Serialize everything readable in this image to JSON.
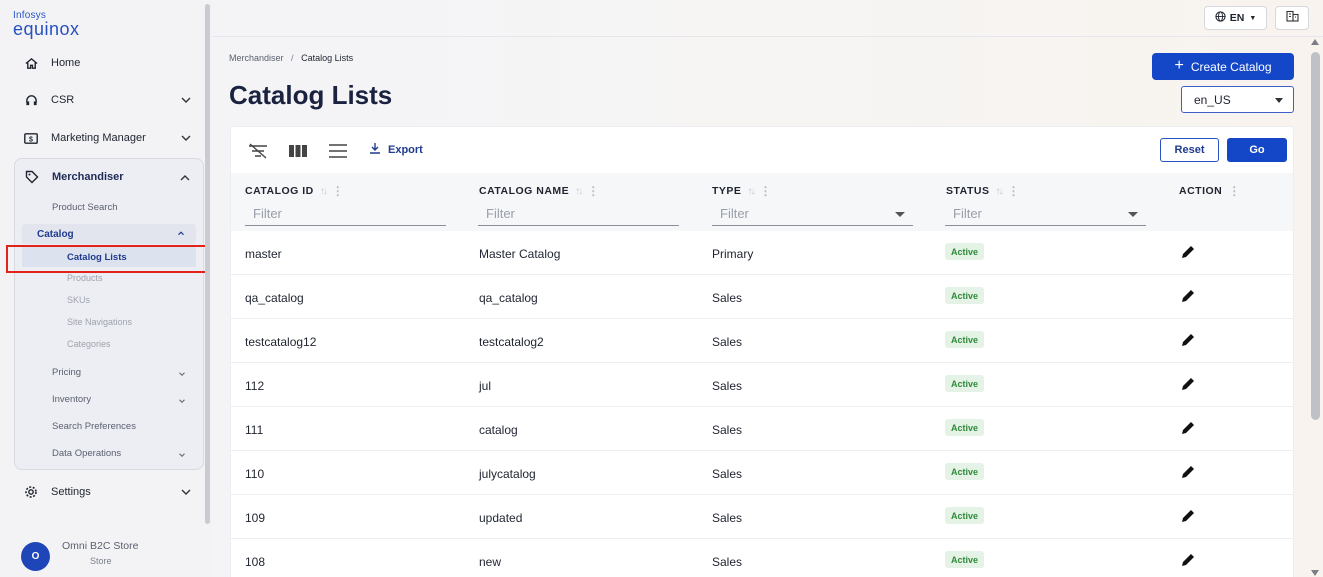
{
  "brand": {
    "line1": "Infosys",
    "line2": "equinox"
  },
  "sidebar": {
    "home": "Home",
    "csr": "CSR",
    "marketing": "Marketing Manager",
    "merchandiser": "Merchandiser",
    "merch_items": {
      "product_search": "Product Search",
      "catalog": "Catalog",
      "catalog_lists": "Catalog Lists",
      "products": "Products",
      "skus": "SKUs",
      "site_navigations": "Site Navigations",
      "categories": "Categories",
      "pricing": "Pricing",
      "inventory": "Inventory",
      "search_preferences": "Search Preferences",
      "data_operations": "Data Operations"
    },
    "settings": "Settings",
    "store": {
      "avatar": "O",
      "name": "Omni B2C Store",
      "type": "Store"
    }
  },
  "topbar": {
    "language": "EN"
  },
  "breadcrumb": {
    "parent": "Merchandiser",
    "separator": "/",
    "current": "Catalog Lists"
  },
  "page": {
    "title": "Catalog Lists",
    "create_button": "Create Catalog",
    "locale": "en_US"
  },
  "toolbar": {
    "export": "Export",
    "reset": "Reset",
    "go": "Go"
  },
  "table": {
    "columns": [
      "CATALOG ID",
      "CATALOG NAME",
      "TYPE",
      "STATUS",
      "ACTION"
    ],
    "filter_placeholder": "Filter",
    "rows": [
      {
        "id": "master",
        "name": "Master Catalog",
        "type": "Primary",
        "status": "Active"
      },
      {
        "id": "qa_catalog",
        "name": "qa_catalog",
        "type": "Sales",
        "status": "Active"
      },
      {
        "id": "testcatalog12",
        "name": "testcatalog2",
        "type": "Sales",
        "status": "Active"
      },
      {
        "id": "112",
        "name": "jul",
        "type": "Sales",
        "status": "Active"
      },
      {
        "id": "111",
        "name": "catalog",
        "type": "Sales",
        "status": "Active"
      },
      {
        "id": "110",
        "name": "julycatalog",
        "type": "Sales",
        "status": "Active"
      },
      {
        "id": "109",
        "name": "updated",
        "type": "Sales",
        "status": "Active"
      },
      {
        "id": "108",
        "name": "new",
        "type": "Sales",
        "status": "Active"
      }
    ]
  },
  "colors": {
    "primary": "#1447c8",
    "active_badge_bg": "#e5f3e6",
    "active_badge_text": "#2e8a3a",
    "highlight": "#e2231a"
  }
}
